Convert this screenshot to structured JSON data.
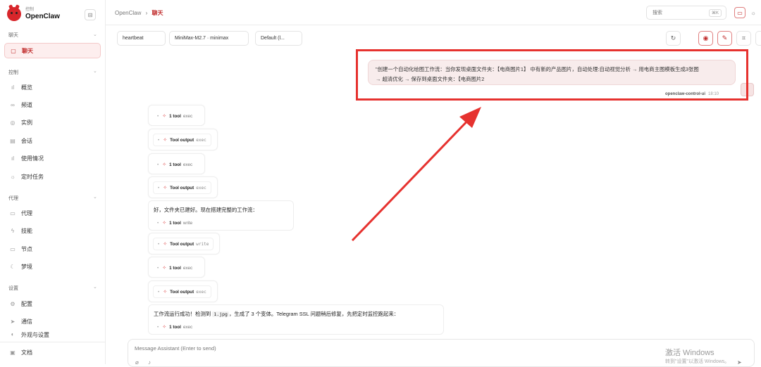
{
  "brand": {
    "subtitle": "控制",
    "name": "OpenClaw"
  },
  "sidebar": {
    "groups": [
      {
        "label": "聊天"
      },
      {
        "label": "控制"
      },
      {
        "label": "代理"
      },
      {
        "label": "设置"
      }
    ],
    "items": [
      {
        "label": "聊天",
        "icon": "chat-icon"
      },
      {
        "label": "概览",
        "icon": "bar-chart-icon"
      },
      {
        "label": "频道",
        "icon": "link-icon"
      },
      {
        "label": "实例",
        "icon": "radio-icon"
      },
      {
        "label": "会话",
        "icon": "document-icon"
      },
      {
        "label": "使用情况",
        "icon": "bar-chart-icon"
      },
      {
        "label": "定时任务",
        "icon": "clock-icon"
      },
      {
        "label": "代理",
        "icon": "folder-icon"
      },
      {
        "label": "技能",
        "icon": "zap-icon"
      },
      {
        "label": "节点",
        "icon": "monitor-icon"
      },
      {
        "label": "梦境",
        "icon": "moon-icon"
      },
      {
        "label": "配置",
        "icon": "gear-icon"
      },
      {
        "label": "通信",
        "icon": "send-icon"
      },
      {
        "label": "外观与设置",
        "icon": "palette-icon"
      },
      {
        "label": "文档",
        "icon": "book-icon"
      }
    ]
  },
  "header": {
    "breadcrumb_root": "OpenClaw",
    "breadcrumb_sep": "›",
    "breadcrumb_current": "聊天",
    "search_placeholder": "搜索",
    "search_shortcut": "⌘K"
  },
  "toolbar": {
    "session": "heartbeat",
    "model": "MiniMax-M2.7 · minimax",
    "thinking": "Default (l..."
  },
  "user_message": {
    "line1": "\"创建一个自动化绘图工作流：当你发现桌面文件夹：【电商图片1】 中有新的产品图片，自动处理:自动视觉分析 → 用电商主图模板生成3张图",
    "line2": "→ 超清优化 → 保存到桌面文件夹：【电商图片2",
    "sender": "openclaw-control-ui",
    "time": "18:10"
  },
  "messages": [
    {
      "label": "1 tool",
      "tool": "exec"
    },
    {
      "label": "Tool output",
      "tool": "exec"
    },
    {
      "label": "1 tool",
      "tool": "exec"
    },
    {
      "label": "Tool output",
      "tool": "exec"
    },
    {
      "text": "好，文件夹已建好。现在搭建完整的工作流：",
      "label": "1 tool",
      "tool": "write"
    },
    {
      "label": "Tool output",
      "tool": "write"
    },
    {
      "label": "1 tool",
      "tool": "exec"
    },
    {
      "label": "Tool output",
      "tool": "exec"
    },
    {
      "text_before": "工作流运行成功！检测到 ",
      "code": "1.jpg",
      "text_after": "，生成了 3 个变体。Telegram SSL 问题稍后修复，先把定时监控跑起来：",
      "label": "1 tool",
      "tool": "exec"
    }
  ],
  "composer": {
    "placeholder": "Message Assistant (Enter to send)"
  },
  "watermark": {
    "title": "激活 Windows",
    "subtitle": "转到\"设置\"以激活 Windows。"
  },
  "colors": {
    "accent": "#c02a2a",
    "annotation": "#e6322f"
  }
}
